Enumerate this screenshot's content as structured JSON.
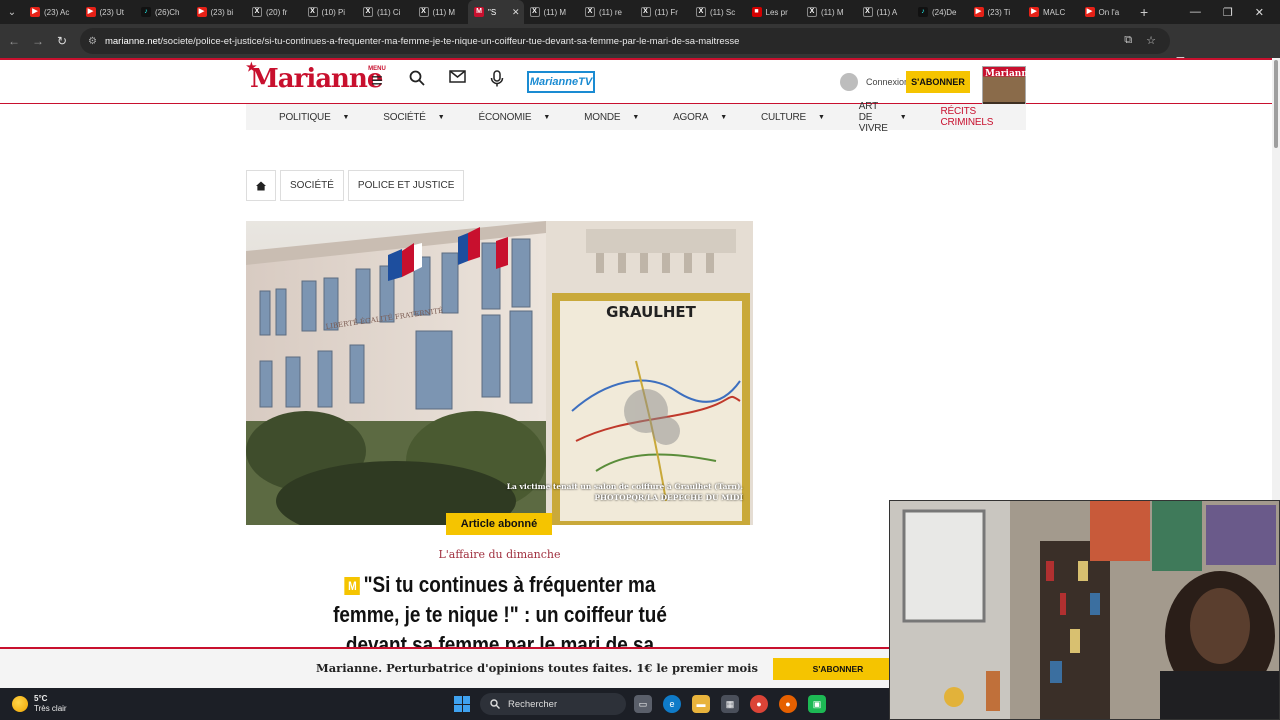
{
  "browser": {
    "tabs": [
      {
        "label": "(23) Ac",
        "icon": "youtube-icon",
        "active": false
      },
      {
        "label": "(23) Ut",
        "icon": "youtube-icon",
        "active": false
      },
      {
        "label": "(26)Ch",
        "icon": "tiktok-icon",
        "active": false
      },
      {
        "label": "(23) bi",
        "icon": "youtube-icon",
        "active": false
      },
      {
        "label": "(20) fr",
        "icon": "x-icon",
        "active": false
      },
      {
        "label": "(10) Pi",
        "icon": "x-icon",
        "active": false
      },
      {
        "label": "(11) Ci",
        "icon": "x-icon",
        "active": false
      },
      {
        "label": "(11) M",
        "icon": "x-icon",
        "active": false
      },
      {
        "label": "\"S",
        "icon": "marianne-icon",
        "active": true
      },
      {
        "label": "(11) M",
        "icon": "x-icon",
        "active": false
      },
      {
        "label": "(11) re",
        "icon": "x-icon",
        "active": false
      },
      {
        "label": "(11) Fr",
        "icon": "x-icon",
        "active": false
      },
      {
        "label": "(11) Sc",
        "icon": "x-icon",
        "active": false
      },
      {
        "label": "Les pr",
        "icon": "lepoint-icon",
        "active": false
      },
      {
        "label": "(11) M",
        "icon": "x-icon",
        "active": false
      },
      {
        "label": "(11) A",
        "icon": "x-icon",
        "active": false
      },
      {
        "label": "(24)De",
        "icon": "tiktok-icon",
        "active": false
      },
      {
        "label": "(23) Ti",
        "icon": "youtube-icon",
        "active": false
      },
      {
        "label": "MALC",
        "icon": "youtube-icon",
        "active": false
      },
      {
        "label": "On l'a",
        "icon": "youtube-icon",
        "active": false
      }
    ],
    "url_domain": "marianne.net",
    "url_path": "/societe/police-et-justice/si-tu-continues-a-frequenter-ma-femme-je-te-nique-un-coiffeur-tue-devant-sa-femme-par-le-mari-de-sa-maitresse"
  },
  "site": {
    "logo": "Marianne",
    "menu_label": "MENU",
    "tv_label": "MarianneTV",
    "login_label": "Connexion",
    "subscribe_label": "S'ABONNER",
    "magazine_title": "Marianne"
  },
  "nav": {
    "items": [
      {
        "label": "Politique",
        "dropdown": true
      },
      {
        "label": "Société",
        "dropdown": true
      },
      {
        "label": "Économie",
        "dropdown": true
      },
      {
        "label": "Monde",
        "dropdown": true
      },
      {
        "label": "Agora",
        "dropdown": true
      },
      {
        "label": "Culture",
        "dropdown": true
      },
      {
        "label": "Art de vivre",
        "dropdown": true
      },
      {
        "label": "Récits criminels",
        "dropdown": false
      }
    ]
  },
  "breadcrumb": {
    "items": [
      "Société",
      "Police et justice"
    ]
  },
  "article": {
    "image_caption_line1": "La victime tenait un salon de coiffure à Graulhet (Tarn).",
    "image_caption_line2": "PHOTOPQR/LA DEPECHE DU MIDI",
    "sign_text": "GRAULHET",
    "facade_text": "LIBERTÉ ÉGALITÉ FRATERNITÉ",
    "badge": "Article abonné",
    "kicker": "L'affaire du dimanche",
    "headline": "\"Si tu continues à fréquenter ma femme, je te nique !\" : un coiffeur tué devant sa femme par le mari de sa",
    "badge_letter": "M"
  },
  "promo": {
    "text": "Marianne. Perturbatrice d'opinions toutes faites. 1€ le premier mois",
    "button": "S'ABONNER"
  },
  "taskbar": {
    "temperature": "5°C",
    "condition": "Très clair",
    "search_placeholder": "Rechercher"
  }
}
